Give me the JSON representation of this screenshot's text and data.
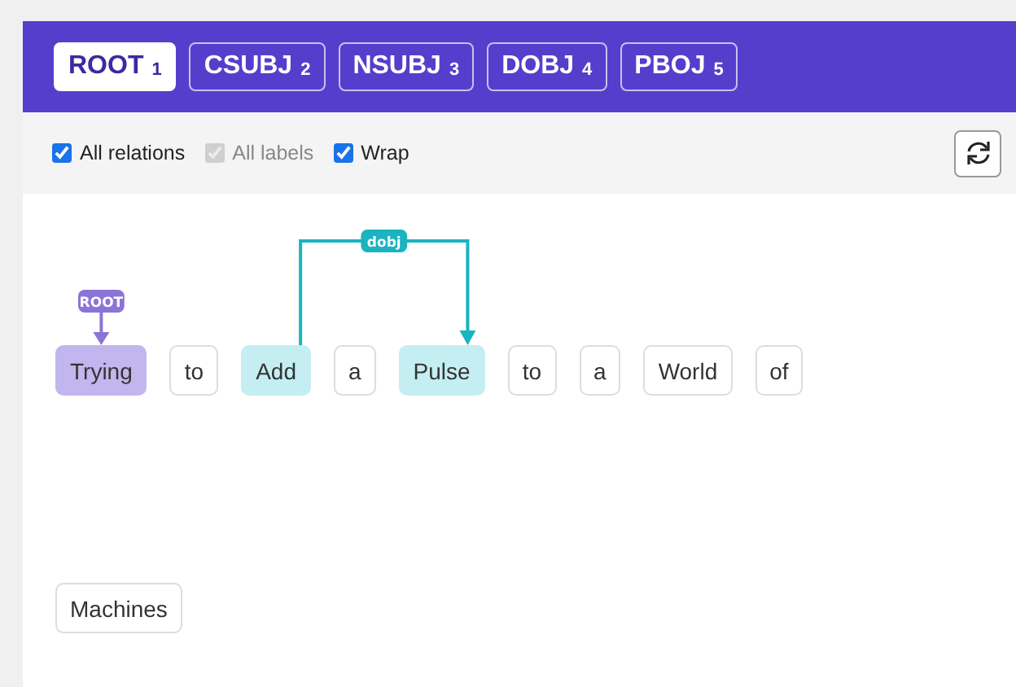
{
  "tabs": [
    {
      "label": "ROOT",
      "count": "1",
      "selected": true
    },
    {
      "label": "CSUBJ",
      "count": "2",
      "selected": false
    },
    {
      "label": "NSUBJ",
      "count": "3",
      "selected": false
    },
    {
      "label": "DOBJ",
      "count": "4",
      "selected": false
    },
    {
      "label": "PBOJ",
      "count": "5",
      "selected": false
    }
  ],
  "options": [
    {
      "label": "All relations",
      "checked": true,
      "disabled": false
    },
    {
      "label": "All labels",
      "checked": true,
      "disabled": true
    },
    {
      "label": "Wrap",
      "checked": true,
      "disabled": false
    }
  ],
  "tokens": [
    {
      "text": "Trying",
      "kind": "root",
      "label": "ROOT"
    },
    {
      "text": "to",
      "kind": "plain"
    },
    {
      "text": "Add",
      "kind": "head",
      "label": "dobj"
    },
    {
      "text": "a",
      "kind": "plain"
    },
    {
      "text": "Pulse",
      "kind": "dependent"
    },
    {
      "text": "to",
      "kind": "plain"
    },
    {
      "text": "a",
      "kind": "plain"
    },
    {
      "text": "World",
      "kind": "plain"
    },
    {
      "text": "of",
      "kind": "plain"
    },
    {
      "text": "Machines",
      "kind": "plain"
    }
  ]
}
